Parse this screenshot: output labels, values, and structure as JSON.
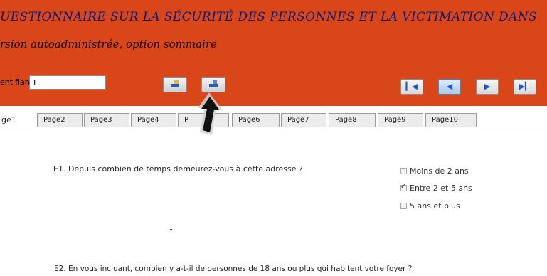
{
  "header": {
    "title": "UESTIONNAIRE SUR LA SÉCURITÉ DES PERSONNES ET LA VICTIMATION DANS",
    "subtitle": "rsion autoadministrée, option sommaire",
    "id_label": "entifiant",
    "id_value": "1"
  },
  "tabs": [
    "ge1",
    "Page2",
    "Page3",
    "Page4",
    "P",
    "Page6",
    "Page7",
    "Page8",
    "Page9",
    "Page10"
  ],
  "questions": {
    "e1": {
      "text": "E1. Depuis combien de temps demeurez-vous à cette adresse ?",
      "options": [
        "Moins de 2 ans",
        "Entre 2 et 5 ans",
        "5 ans et plus"
      ],
      "checked_index": 1
    },
    "e2": {
      "text": "E2. En vous incluant, combien y a-t-il de personnes de 18 ans ou plus qui habitent votre foyer ?"
    }
  },
  "colors": {
    "header_bg": "#d9461a",
    "title_color": "#0a1a7a"
  },
  "icons": [
    "first-page-icon",
    "previous-page-icon",
    "next-page-icon",
    "last-page-icon",
    "cursor-arrow-icon"
  ]
}
